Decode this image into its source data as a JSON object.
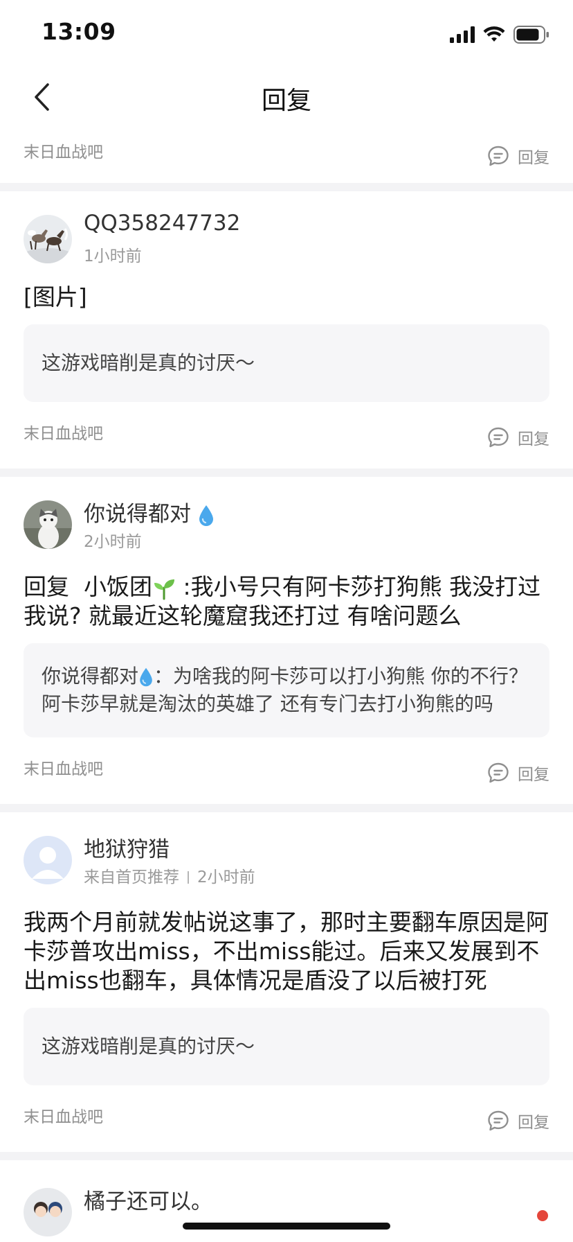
{
  "status_bar": {
    "time": "13:09"
  },
  "header": {
    "title": "回复"
  },
  "reply_label": "回复",
  "cards": [
    {
      "forum": "末日血战吧"
    },
    {
      "author": "QQ358247732",
      "time": "1小时前",
      "body": "[图片]",
      "quote": "这游戏暗削是真的讨厌～",
      "forum": "末日血战吧"
    },
    {
      "author": "你说得都对",
      "time": "2小时前",
      "body_reply_prefix": "回复",
      "body_reply_to": "小饭团",
      "body_rest": " :我小号只有阿卡莎打狗熊  我没打过我说?   就最近这轮魔窟我还打过  有啥问题么",
      "quote_author": "你说得都对",
      "quote_rest": "：为啥我的阿卡莎可以打小狗熊 你的不行？ 阿卡莎早就是淘汰的英雄了 还有专门去打小狗熊的吗",
      "forum": "末日血战吧"
    },
    {
      "author": "地狱狩猎",
      "source": "来自首页推荐",
      "time": "2小时前",
      "body": "我两个月前就发帖说这事了，那时主要翻车原因是阿卡莎普攻出miss，不出miss能过。后来又发展到不出miss也翻车，具体情况是盾没了以后被打死",
      "quote": "这游戏暗削是真的讨厌～",
      "forum": "末日血战吧"
    },
    {
      "author": "橘子还可以。"
    }
  ]
}
